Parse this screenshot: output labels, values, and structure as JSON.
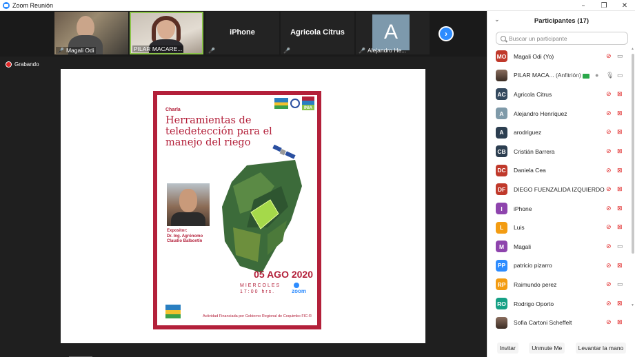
{
  "window": {
    "title": "Zoom Reunión",
    "controls": [
      "–",
      "❐",
      "✕"
    ]
  },
  "video_strip": {
    "tiles": [
      {
        "name": "Magali Odi",
        "type": "video"
      },
      {
        "name": "PILAR MACARE...",
        "type": "video",
        "active": true
      },
      {
        "name": "iPhone",
        "type": "name"
      },
      {
        "name": "Agricola Citrus",
        "type": "name"
      },
      {
        "name": "Alejandro He...",
        "type": "avatar",
        "initial": "A"
      }
    ],
    "next_icon": "chevron-right-icon"
  },
  "recording": {
    "label": "Grabando"
  },
  "poster": {
    "kicker": "Charla",
    "title": "Herramientas de teledetección para el manejo del riego",
    "logo_text": "INIA",
    "speaker_lines": [
      "Expositor:",
      "Dr. Ing. Agrónomo",
      "Claudio Balbontín"
    ],
    "date": "05 AGO 2020",
    "weekday": "MIERCOLES",
    "time": "17:00 hrs.",
    "zoom_label": "zoom",
    "footer": "Actividad Financiada por Gobierno Regional de Coquimbo FIC-R"
  },
  "participants": {
    "title": "Participantes (17)",
    "search_placeholder": "Buscar un participante",
    "list": [
      {
        "initials": "MO",
        "color": "#c0392b",
        "name": "Magali Odi (Yo)",
        "mic": "off",
        "cam": "on"
      },
      {
        "initials": "",
        "color": "",
        "name": "PILAR MACA...",
        "role": "(Anfitrión)",
        "photo": true,
        "mic": "on",
        "cam": "on"
      },
      {
        "initials": "AC",
        "color": "#34495e",
        "name": "Agricola Citrus",
        "mic": "off",
        "cam": "off"
      },
      {
        "initials": "A",
        "color": "#7f9aa9",
        "name": "Alejandro Henríquez",
        "mic": "off",
        "cam": "off"
      },
      {
        "initials": "A",
        "color": "#2c3e50",
        "name": "arodriguez",
        "mic": "off",
        "cam": "off"
      },
      {
        "initials": "CB",
        "color": "#2c3e50",
        "name": "Cristián Barrera",
        "mic": "off",
        "cam": "off"
      },
      {
        "initials": "DC",
        "color": "#c0392b",
        "name": "Daniela Cea",
        "mic": "off",
        "cam": "off"
      },
      {
        "initials": "DF",
        "color": "#c0392b",
        "name": "DIEGO FUENZALIDA IZQUIERDO",
        "mic": "off",
        "cam": "off"
      },
      {
        "initials": "I",
        "color": "#8e44ad",
        "name": "iPhone",
        "mic": "off",
        "cam": "off"
      },
      {
        "initials": "L",
        "color": "#f39c12",
        "name": "Luis",
        "mic": "off",
        "cam": "off"
      },
      {
        "initials": "M",
        "color": "#8e44ad",
        "name": "Magali",
        "mic": "off",
        "cam": "on"
      },
      {
        "initials": "PP",
        "color": "#2d8cff",
        "name": "patricio pizarro",
        "mic": "off",
        "cam": "off"
      },
      {
        "initials": "RP",
        "color": "#f39c12",
        "name": "Raimundo perez",
        "mic": "off",
        "cam": "on"
      },
      {
        "initials": "RO",
        "color": "#16a085",
        "name": "Rodrigo Oporto",
        "mic": "off",
        "cam": "off"
      },
      {
        "initials": "",
        "color": "",
        "name": "Sofia Cartoni Scheffelt",
        "photo": true,
        "mic": "off",
        "cam": "off"
      }
    ],
    "footer_buttons": [
      "Invitar",
      "Unmute Me",
      "Levantar la mano"
    ]
  }
}
